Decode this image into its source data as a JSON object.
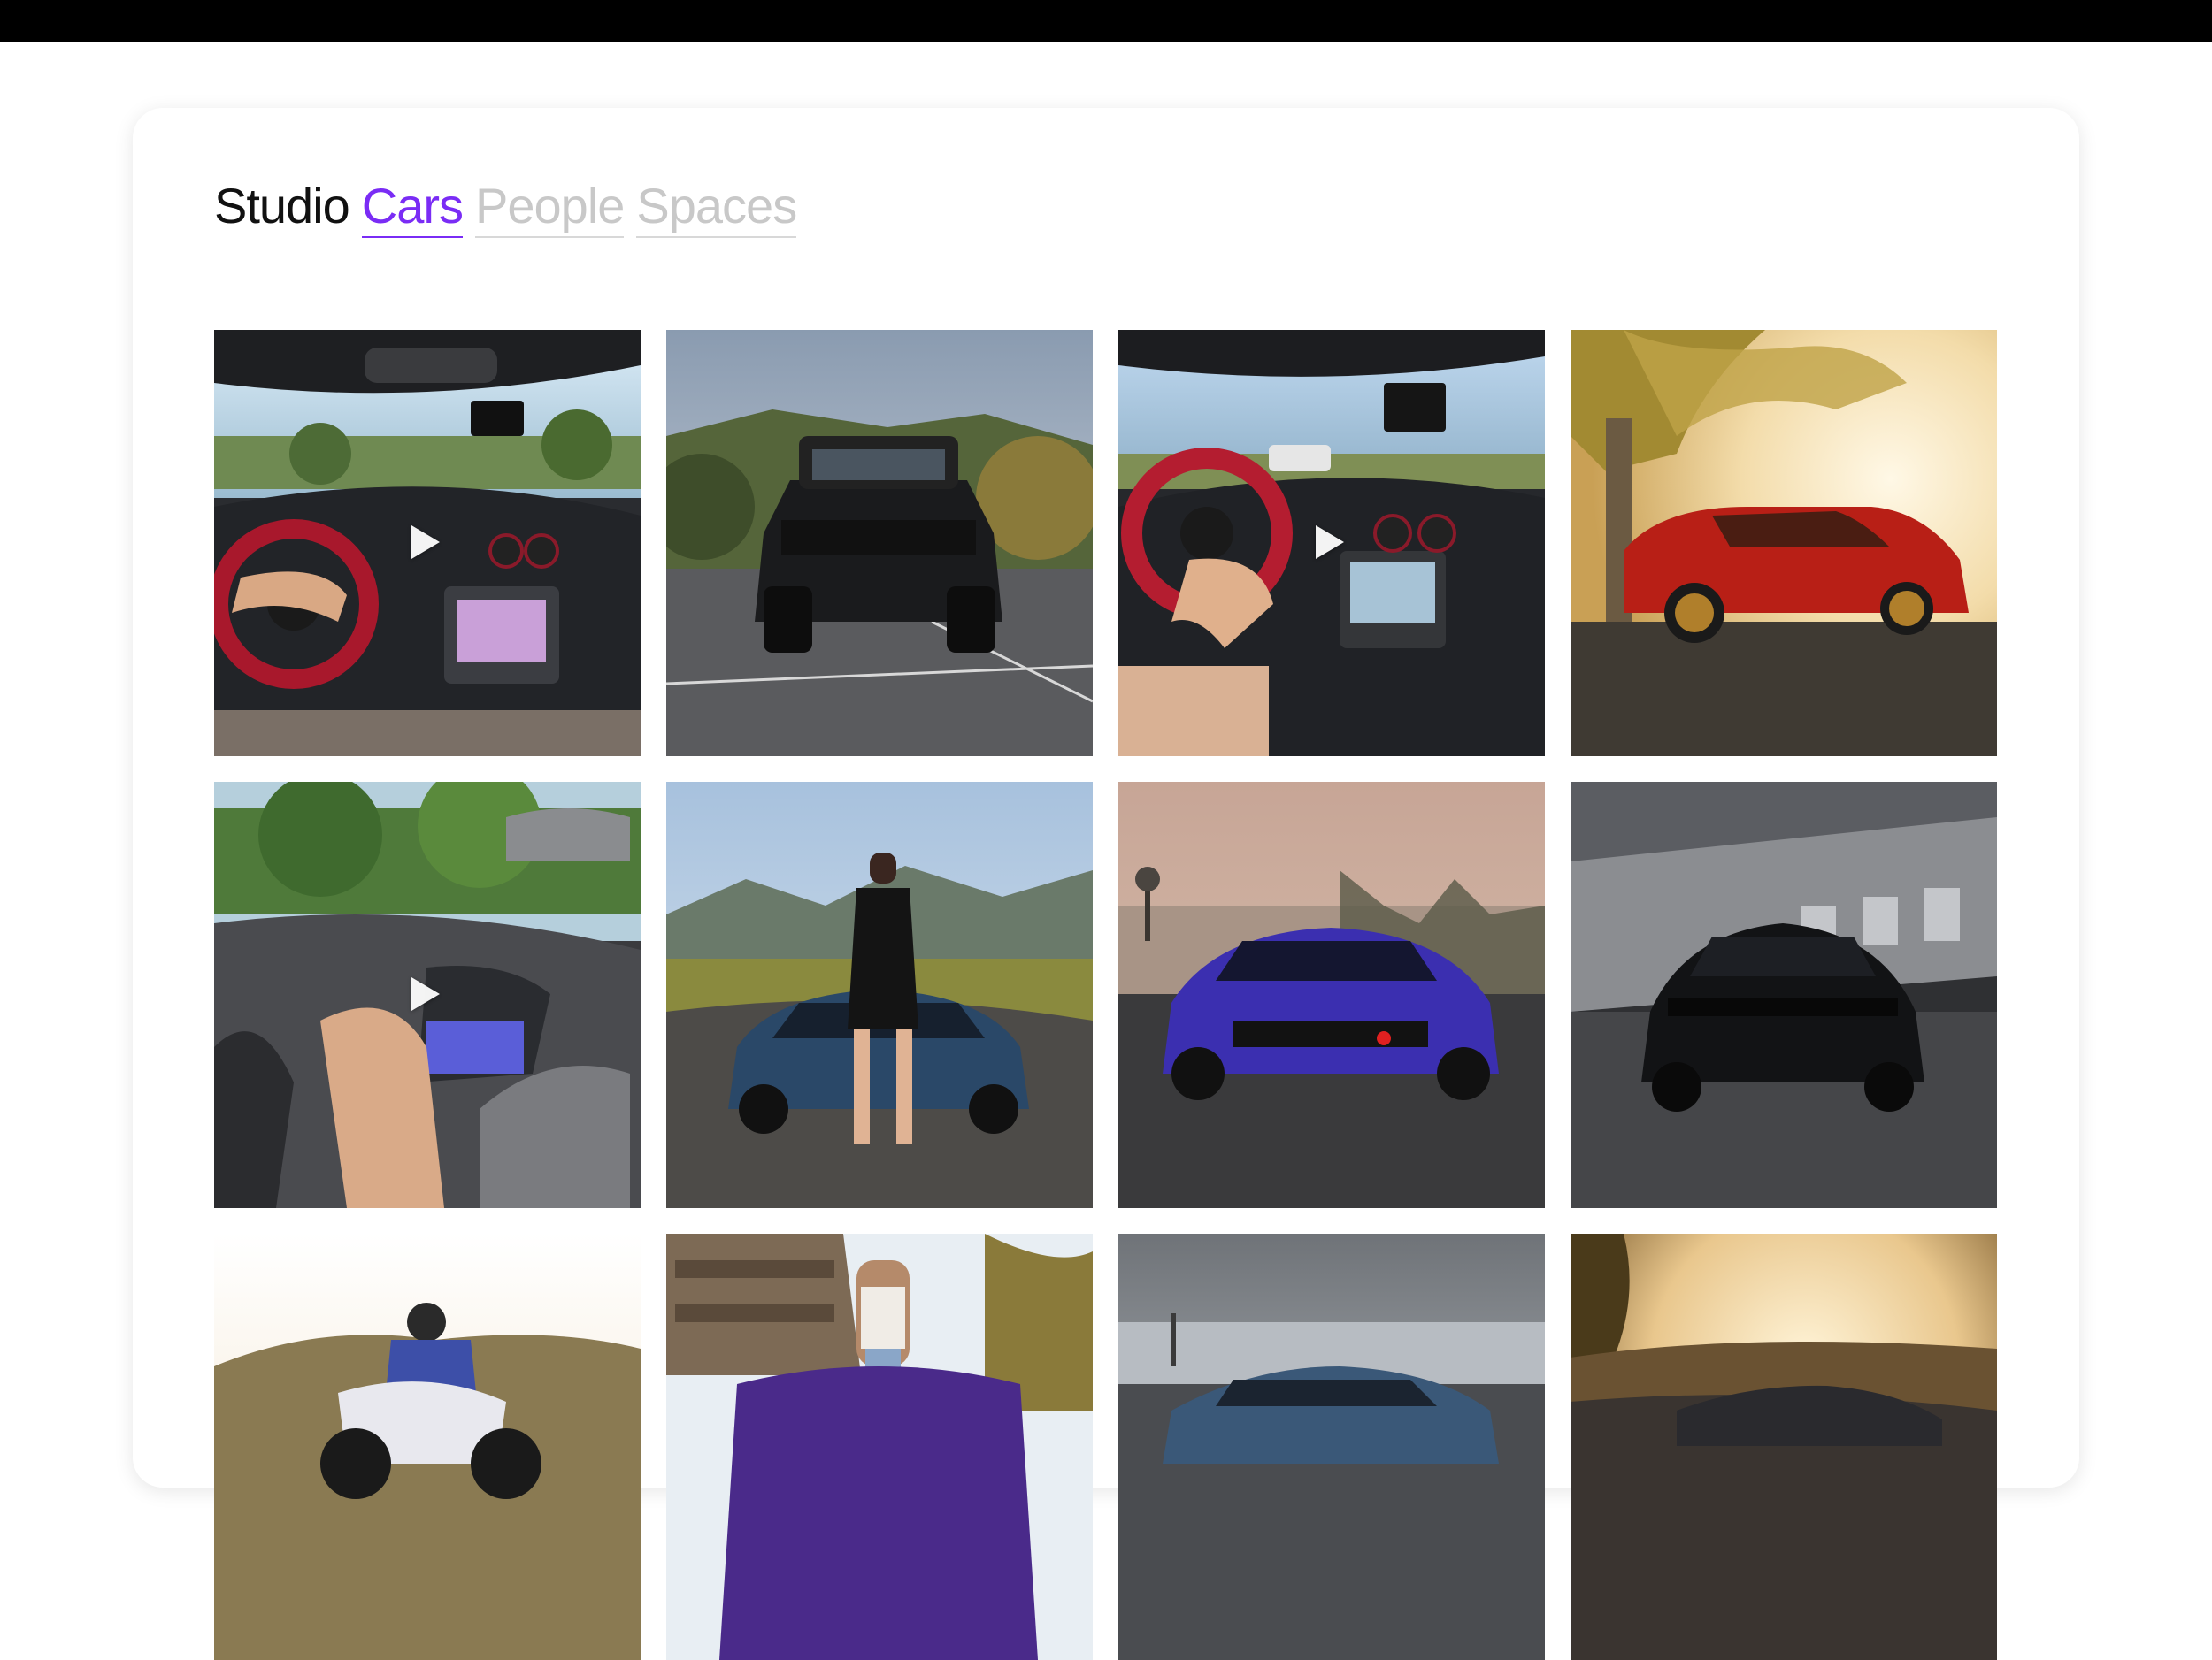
{
  "header": {
    "studio_label": "Studio",
    "tabs": [
      {
        "label": "Cars",
        "active": true
      },
      {
        "label": "People",
        "active": false
      },
      {
        "label": "Spaces",
        "active": false
      }
    ]
  },
  "colors": {
    "accent": "#7a2cf5",
    "inactive_tab": "#c8c8c8",
    "top_bar": "#000000"
  },
  "gallery": {
    "items": [
      {
        "kind": "video",
        "icon": "play-icon",
        "subject": "car interior dashboard driving"
      },
      {
        "kind": "photo",
        "subject": "black pickup truck in parking lot"
      },
      {
        "kind": "video",
        "icon": "play-icon",
        "subject": "car interior steering wheel driving"
      },
      {
        "kind": "photo",
        "subject": "red sports coupe under tree at sunset"
      },
      {
        "kind": "video",
        "icon": "play-icon",
        "subject": "supercar interior hand on wheel"
      },
      {
        "kind": "photo",
        "subject": "model posing with blue supercar"
      },
      {
        "kind": "photo",
        "subject": "purple muscle car by the ocean"
      },
      {
        "kind": "photo",
        "subject": "black sedan in front of warehouse"
      },
      {
        "kind": "photo",
        "subject": "motorcycle rider on hillside"
      },
      {
        "kind": "photo",
        "subject": "model with purple car"
      },
      {
        "kind": "photo",
        "subject": "silver sports car by the sea"
      },
      {
        "kind": "photo",
        "subject": "car on road at sunset"
      }
    ]
  }
}
